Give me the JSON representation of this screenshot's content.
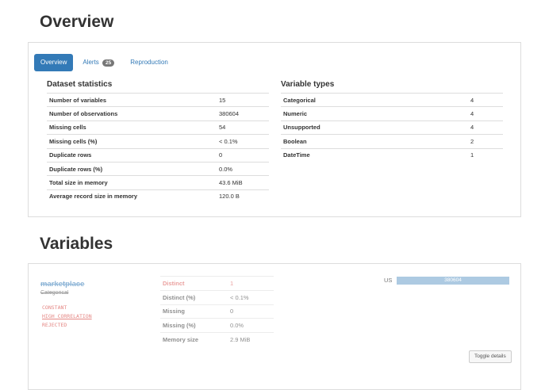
{
  "overview": {
    "heading": "Overview",
    "tabs": [
      {
        "label": "Overview"
      },
      {
        "label": "Alerts",
        "badge": "25"
      },
      {
        "label": "Reproduction"
      }
    ],
    "dataset_statistics": {
      "title": "Dataset statistics",
      "rows": [
        {
          "label": "Number of variables",
          "value": "15"
        },
        {
          "label": "Number of observations",
          "value": "380604"
        },
        {
          "label": "Missing cells",
          "value": "54"
        },
        {
          "label": "Missing cells (%)",
          "value": "< 0.1%"
        },
        {
          "label": "Duplicate rows",
          "value": "0"
        },
        {
          "label": "Duplicate rows (%)",
          "value": "0.0%"
        },
        {
          "label": "Total size in memory",
          "value": "43.6 MiB"
        },
        {
          "label": "Average record size in memory",
          "value": "120.0 B"
        }
      ]
    },
    "variable_types": {
      "title": "Variable types",
      "rows": [
        {
          "label": "Categorical",
          "value": "4"
        },
        {
          "label": "Numeric",
          "value": "4"
        },
        {
          "label": "Unsupported",
          "value": "4"
        },
        {
          "label": "Boolean",
          "value": "2"
        },
        {
          "label": "DateTime",
          "value": "1"
        }
      ]
    }
  },
  "variables": {
    "heading": "Variables",
    "items": [
      {
        "name": "marketplace",
        "type": "Categorical",
        "tags": [
          "CONSTANT",
          "HIGH CORRELATION",
          "REJECTED"
        ],
        "stats": [
          {
            "label": "Distinct",
            "value": "1"
          },
          {
            "label": "Distinct (%)",
            "value": "< 0.1%"
          },
          {
            "label": "Missing",
            "value": "0"
          },
          {
            "label": "Missing (%)",
            "value": "0.0%"
          },
          {
            "label": "Memory size",
            "value": "2.9 MiB"
          }
        ],
        "bar": {
          "category": "US",
          "count": "380604",
          "fraction": 1.0
        },
        "toggle_label": "Toggle details"
      }
    ]
  }
}
